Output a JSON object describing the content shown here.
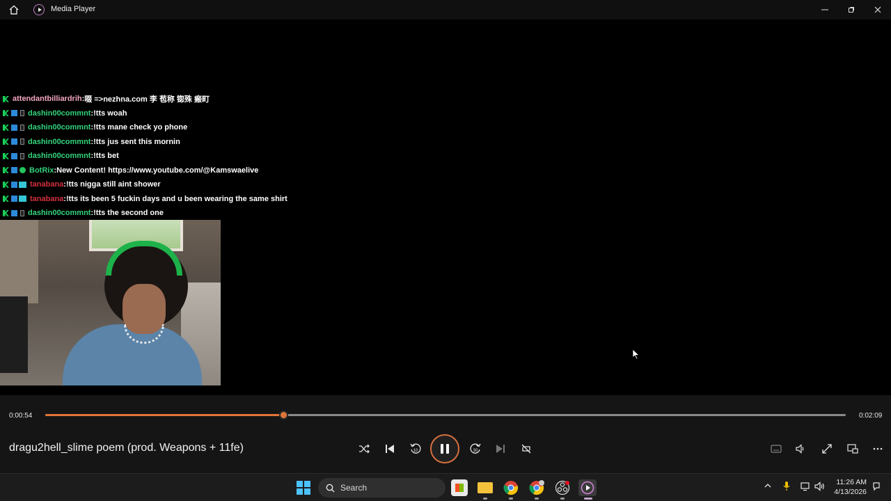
{
  "app": {
    "title": "Media Player"
  },
  "chat": [
    {
      "user": "attendantbilliardrih",
      "sep": " : ",
      "msg": "啜 =>nezhna.com 李 苞称 锪殊 瘢町"
    },
    {
      "user": "dashin00commnt",
      "sep": " : ",
      "msg": "!tts woah"
    },
    {
      "user": "dashin00commnt",
      "sep": " : ",
      "msg": "!tts mane check yo phone"
    },
    {
      "user": "dashin00commnt",
      "sep": " : ",
      "msg": "!tts jus sent this mornin"
    },
    {
      "user": "dashin00commnt",
      "sep": " : ",
      "msg": "!tts bet"
    },
    {
      "user": "BotRix",
      "sep": " : ",
      "msg": "New Content! https://www.youtube.com/@Kamswaelive"
    },
    {
      "user": "tanabana",
      "sep": " : ",
      "msg": "!tts nigga still aint shower"
    },
    {
      "user": "tanabana",
      "sep": " : ",
      "msg": "!tts its been 5 fuckin days and u been wearing the same shirt"
    },
    {
      "user": "dashin00commnt",
      "sep": " : ",
      "msg": "!tts the second one"
    }
  ],
  "player": {
    "current_time": "0:00:54",
    "total_time": "0:02:09",
    "progress": 0.297,
    "track_title": "dragu2hell_slime poem (prod. Weapons + 11fe)"
  },
  "taskbar": {
    "search_label": "Search",
    "time": "11:26 AM",
    "date": "4/13/2026"
  },
  "colors": {
    "accent": "#e0763a",
    "chat_green": "#33d47c",
    "chat_pink": "#f3a6c1",
    "chat_red": "#d4303f"
  }
}
